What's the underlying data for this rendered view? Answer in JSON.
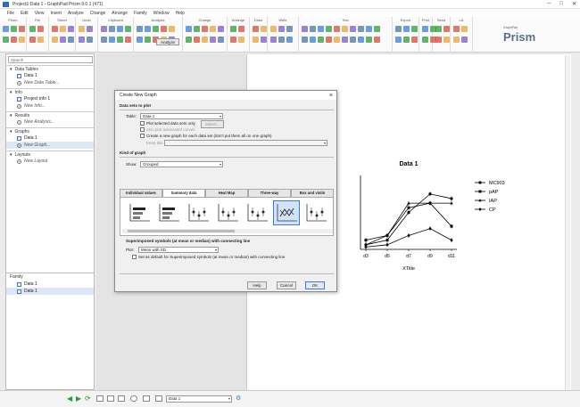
{
  "window": {
    "title": "Project1:Data 1 - GraphPad Prism 9.0.1 (471)"
  },
  "menubar": [
    "File",
    "Edit",
    "View",
    "Insert",
    "Analyze",
    "Change",
    "Arrange",
    "Family",
    "Window",
    "Help"
  ],
  "ribbon_groups": [
    "Prism",
    "File",
    "Sheet",
    "Undo",
    "Clipboard",
    "Analysis",
    "Change",
    "Arrange",
    "Draw",
    "Write",
    "Text",
    "Export",
    "Print",
    "Send",
    "LA"
  ],
  "ribbon_analyze_label": "Analyze",
  "logo": {
    "top": "GraphPad",
    "main": "Prism"
  },
  "navigator": {
    "search_placeholder": "Search",
    "sections": [
      {
        "title": "Data Tables",
        "items": [
          {
            "label": "Data 1",
            "add": false
          },
          {
            "label": "New Data Table...",
            "add": true
          }
        ]
      },
      {
        "title": "Info",
        "items": [
          {
            "label": "Project info 1",
            "add": false
          },
          {
            "label": "New Info...",
            "add": true
          }
        ]
      },
      {
        "title": "Results",
        "items": [
          {
            "label": "New Analysis...",
            "add": true
          }
        ]
      },
      {
        "title": "Graphs",
        "items": [
          {
            "label": "Data 1",
            "add": false
          },
          {
            "label": "New Graph...",
            "add": true
          }
        ]
      },
      {
        "title": "Layouts",
        "items": [
          {
            "label": "New Layout",
            "add": true
          }
        ]
      }
    ]
  },
  "family": {
    "title": "Family",
    "items": [
      "Data 1",
      "Data 1"
    ]
  },
  "dialog": {
    "title": "Create New Graph",
    "data_sets_heading": "Data sets to plot",
    "table_label": "Table:",
    "table_value": "Data 1",
    "plot_selected_only": "Plot selected data sets only",
    "select_button": "Select...",
    "also_plot_curves": "Also plot associated curves",
    "new_graph_each": "Create a new graph for each data set (don't put them all on one graph)",
    "keep_label": "Keep title",
    "kind_heading": "Kind of graph",
    "show_label": "Show:",
    "show_value": "Grouped",
    "tabs": [
      "Individual values",
      "Summary data",
      "Heat Map",
      "Three-way",
      "Box and violin"
    ],
    "active_tab": 1,
    "description": "Superimposed symbols (at mean or median) with connecting line",
    "plot_label": "Plot:",
    "plot_value": "Mean with SD",
    "default_chk": "Set as default for Superimposed symbols (at mean or median) with connecting line",
    "help_button": "Help",
    "cancel_button": "Cancel",
    "ok_button": "OK"
  },
  "bottombar": {
    "sheet_select": "Data 1"
  },
  "chart_data": {
    "type": "line",
    "title": "Data 1",
    "xlabel": "XTitle",
    "ylabel": "",
    "categories": [
      "d3",
      "d5",
      "d7",
      "d9",
      "d11"
    ],
    "series": [
      {
        "name": "MC903",
        "marker": "circle",
        "values": [
          1,
          2,
          8,
          12,
          11
        ]
      },
      {
        "name": "pAP",
        "marker": "square",
        "values": [
          2,
          3,
          9,
          10,
          5
        ]
      },
      {
        "name": "IAP",
        "marker": "triangle",
        "values": [
          1,
          3,
          10,
          10,
          10
        ]
      },
      {
        "name": "CP",
        "marker": "diamond",
        "values": [
          0.5,
          1,
          3,
          4.5,
          2
        ]
      }
    ],
    "ylim": [
      0,
      16
    ],
    "grid": false,
    "legend": "right"
  },
  "colors": {
    "accent": "#3a7bd5",
    "logo": "#5a6f8a"
  }
}
